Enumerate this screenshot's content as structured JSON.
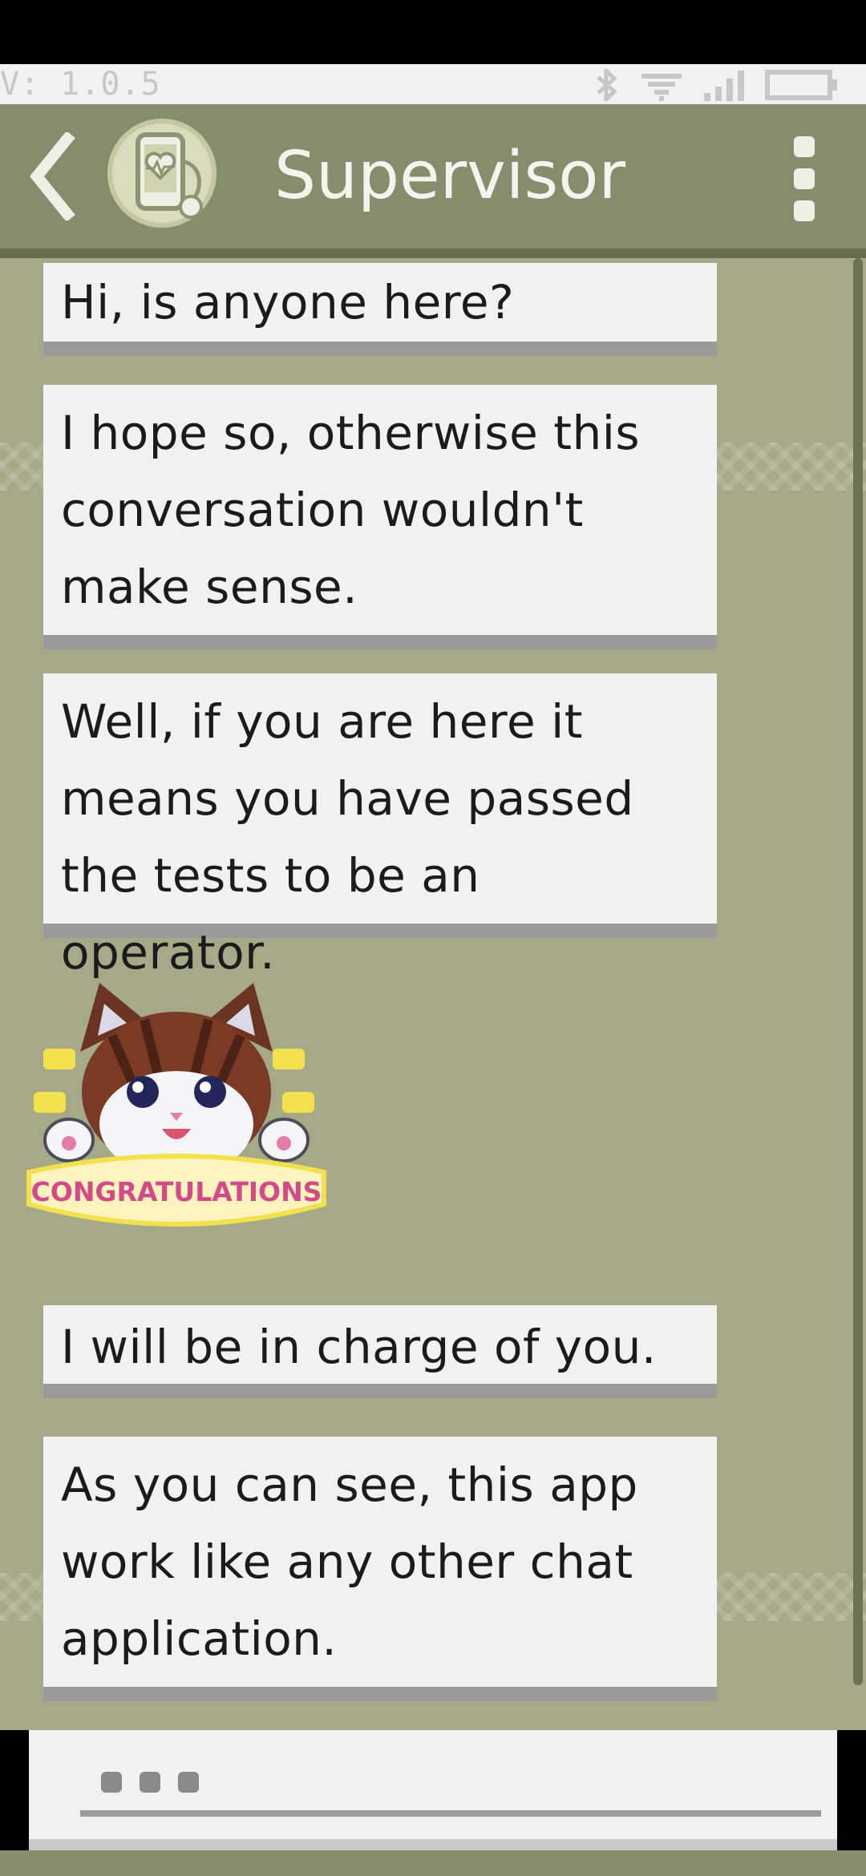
{
  "status_bar": {
    "version": "V: 1.0.5"
  },
  "header": {
    "title": "Supervisor"
  },
  "messages": [
    {
      "text": "Hi, is anyone here?"
    },
    {
      "text": "I hope so, otherwise this conversation wouldn't make sense."
    },
    {
      "text": "Well, if you are here it means you have passed the tests to be an operator."
    },
    {
      "text": "I will be in charge of you."
    },
    {
      "text": "As you can see, this app work like any other chat application."
    }
  ],
  "sticker": {
    "banner_text": "CONGRATULATIONS"
  },
  "colors": {
    "header_bg": "#868d6d",
    "chat_bg": "#a5a987",
    "bubble_bg": "#f1f1f1",
    "bubble_shadow": "#9a9a9a",
    "text": "#1b1b1b"
  },
  "icons": {
    "back": "back-arrow-icon",
    "avatar": "heart-phone-avatar-icon",
    "menu": "more-vertical-icon",
    "bluetooth": "bluetooth-icon",
    "wifi": "wifi-icon",
    "signal": "signal-icon",
    "battery": "battery-icon"
  }
}
